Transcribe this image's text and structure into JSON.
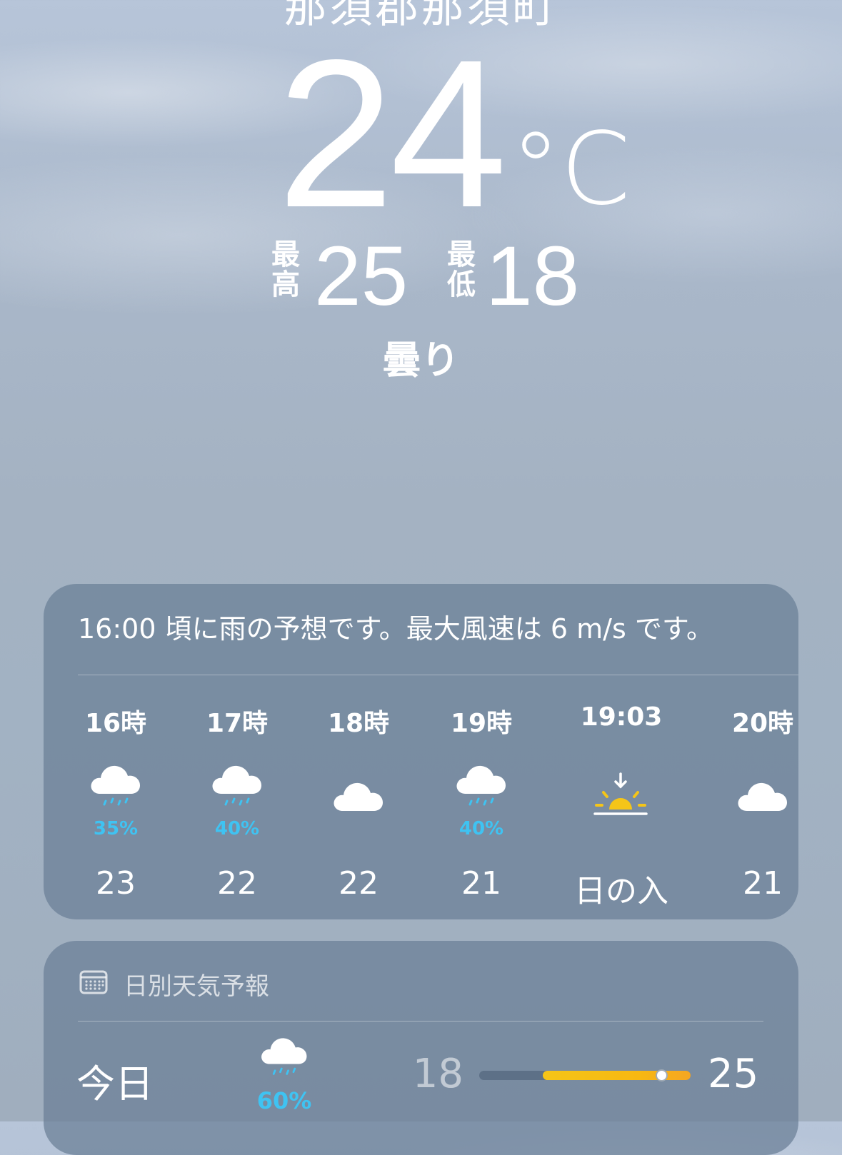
{
  "location": "那須郡那須町",
  "current": {
    "temperature": "24",
    "unit": "°C",
    "high_label_top": "最",
    "high_label_bottom": "高",
    "high": "25",
    "low_label_top": "最",
    "low_label_bottom": "低",
    "low": "18",
    "condition": "曇り"
  },
  "hourly": {
    "summary": "16:00 頃に雨の予想です。最大風速は 6 m/s です。",
    "items": [
      {
        "time": "16時",
        "icon": "cloud-rain-icon",
        "pop": "35%",
        "temp": "23"
      },
      {
        "time": "17時",
        "icon": "cloud-rain-icon",
        "pop": "40%",
        "temp": "22"
      },
      {
        "time": "18時",
        "icon": "cloud-icon",
        "pop": "",
        "temp": "22"
      },
      {
        "time": "19時",
        "icon": "cloud-rain-icon",
        "pop": "40%",
        "temp": "21"
      },
      {
        "time": "19:03",
        "icon": "sunset-icon",
        "pop": "",
        "temp": "日の入"
      },
      {
        "time": "20時",
        "icon": "cloud-icon",
        "pop": "",
        "temp": "21"
      }
    ]
  },
  "daily": {
    "title": "日別天気予報",
    "icon": "calendar-icon",
    "days": [
      {
        "day": "今日",
        "icon": "cloud-rain-icon",
        "pop": "60%",
        "low": "18",
        "high": "25",
        "range_start_fraction": 0.3,
        "range_end_fraction": 1.0,
        "current_fraction": 0.86
      }
    ]
  },
  "colors": {
    "precip": "#3fc3f2",
    "sun": "#f5c518",
    "range_bar": "#f7b811"
  }
}
